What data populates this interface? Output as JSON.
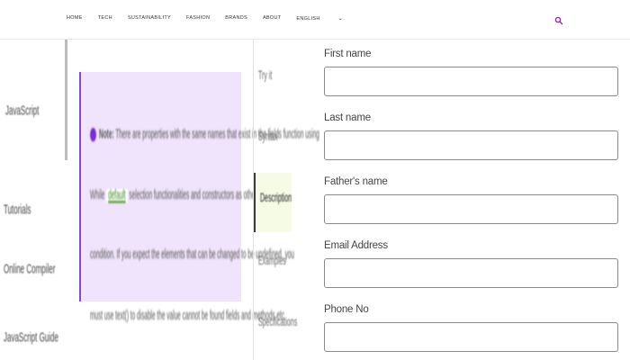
{
  "nav": {
    "items": [
      "HOME",
      "TECH",
      "SUSTAINABILITY",
      "FASHION",
      "BRANDS",
      "ABOUT",
      "ENGLISH"
    ]
  },
  "sidebar": {
    "items": [
      "JavaScript",
      "Tutorials",
      "Online Compiler",
      "JavaScript Guide"
    ]
  },
  "note": {
    "line1_prefix": "Note:",
    "line1": "There are properties with the same names that exist in the fields function using",
    "line2_a": "While",
    "line2_code": "default",
    "line2_b": "selection functionalities and constructors as other",
    "line3": "condition. If you expect the elements that can be changed to be undefined, you",
    "below": "must use text() to disable the value cannot be found fields and methods etc"
  },
  "tabs": [
    "Try it",
    "Syntax",
    "Description",
    "Examples",
    "Specifications"
  ],
  "form": {
    "fields": [
      {
        "label": "First name",
        "value": ""
      },
      {
        "label": "Last name",
        "value": ""
      },
      {
        "label": "Father's name",
        "value": ""
      },
      {
        "label": "Email Address",
        "value": ""
      },
      {
        "label": "Phone No",
        "value": ""
      }
    ]
  },
  "colors": {
    "accent": "#a020c8",
    "note_bg": "#efe4fb",
    "note_border": "#8b44d6"
  }
}
